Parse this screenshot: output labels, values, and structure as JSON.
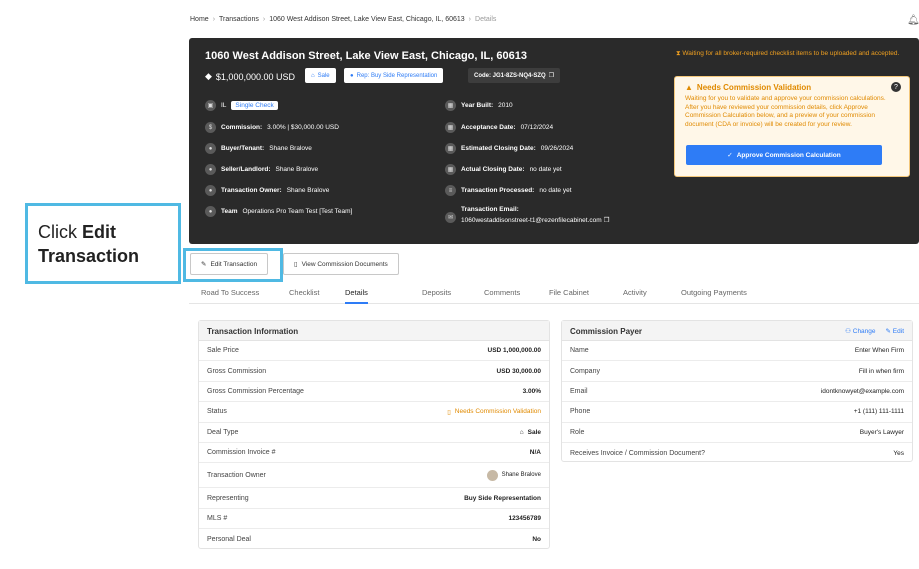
{
  "breadcrumb": {
    "items": [
      "Home",
      "Transactions",
      "1060 West Addison Street, Lake View East, Chicago, IL, 60613"
    ],
    "current": "Details"
  },
  "hero": {
    "title": "1060 West Addison Street, Lake View East, Chicago, IL, 60613",
    "price": "$1,000,000.00 USD",
    "chip_sale": "Sale",
    "chip_rep": "Rep: Buy Side Representation",
    "chip_code": "Code: JG1-8ZS-NQ4-SZQ",
    "state": "IL",
    "single_check": "Single Check",
    "commission_label": "Commission:",
    "commission_value": "3.00% | $30,000.00 USD",
    "buyer_label": "Buyer/Tenant:",
    "buyer_value": "Shane Bralove",
    "seller_label": "Seller/Landlord:",
    "seller_value": "Shane Bralove",
    "owner_label": "Transaction Owner:",
    "owner_value": "Shane Bralove",
    "team_label": "Team",
    "team_value": "Operations Pro Team Test [Test Team]",
    "year_label": "Year Built:",
    "year_value": "2010",
    "acceptance_label": "Acceptance Date:",
    "acceptance_value": "07/12/2024",
    "est_close_label": "Estimated Closing Date:",
    "est_close_value": "09/26/2024",
    "actual_close_label": "Actual Closing Date:",
    "actual_close_value": "no date yet",
    "processed_label": "Transaction Processed:",
    "processed_value": "no date yet",
    "email_label": "Transaction Email:",
    "email_value": "1060westaddisonstreet-t1@rezenfilecabinet.com",
    "waiting": "Waiting for all broker-required checklist items to be uploaded and accepted.",
    "notice_title": "Needs Commission Validation",
    "notice_text": "Waiting for you to validate and approve your commission calculations. After you have reviewed your commission details, click Approve Commission Calculation below, and a preview of your commission document (CDA or invoice) will be created for your review.",
    "approve_label": "Approve Commission Calculation"
  },
  "callout": {
    "prefix": "Click",
    "strong": "Edit Transaction"
  },
  "actions": {
    "edit_label": "Edit Transaction",
    "view_docs_label": "View Commission Documents"
  },
  "tabs": [
    "Road To Success",
    "Checklist",
    "Details",
    "Deposits",
    "Comments",
    "File Cabinet",
    "Activity",
    "Outgoing Payments"
  ],
  "transaction_info": {
    "title": "Transaction Information",
    "rows": [
      {
        "label": "Sale Price",
        "value": "USD 1,000,000.00"
      },
      {
        "label": "Gross Commission",
        "value": "USD 30,000.00"
      },
      {
        "label": "Gross Commission Percentage",
        "value": "3.00%"
      },
      {
        "label": "Status",
        "value": "Needs Commission Validation"
      },
      {
        "label": "Deal Type",
        "value": "Sale"
      },
      {
        "label": "Commission Invoice #",
        "value": "N/A"
      },
      {
        "label": "Transaction Owner",
        "value": "Shane Bralove"
      },
      {
        "label": "Representing",
        "value": "Buy Side Representation"
      },
      {
        "label": "MLS #",
        "value": "123456789"
      },
      {
        "label": "Personal Deal",
        "value": "No"
      }
    ]
  },
  "commission_payer": {
    "title": "Commission Payer",
    "change_label": "Change",
    "edit_label": "Edit",
    "rows": [
      {
        "label": "Name",
        "value": "Enter When Firm"
      },
      {
        "label": "Company",
        "value": "Fill in when firm"
      },
      {
        "label": "Email",
        "value": "idontknowyet@example.com"
      },
      {
        "label": "Phone",
        "value": "+1 (111) 111-1111"
      },
      {
        "label": "Role",
        "value": "Buyer's Lawyer"
      },
      {
        "label": "Receives Invoice / Commission Document?",
        "value": "Yes"
      }
    ]
  }
}
